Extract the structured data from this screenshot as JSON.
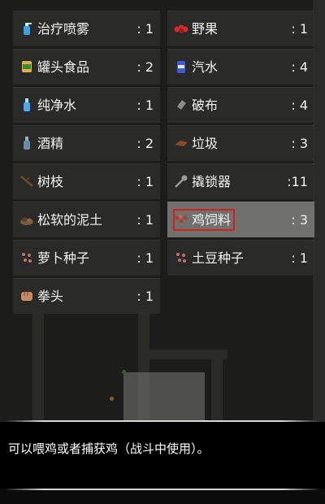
{
  "inventory": {
    "left": [
      {
        "name": "治疗喷雾",
        "qty": ": 1",
        "icon": "spray-icon",
        "color": "#3aa0e8"
      },
      {
        "name": "罐头食品",
        "qty": ": 2",
        "icon": "canned-food-icon",
        "color": "#e0b23a"
      },
      {
        "name": "纯净水",
        "qty": ": 1",
        "icon": "water-bottle-icon",
        "color": "#4aa8f0"
      },
      {
        "name": "酒精",
        "qty": ": 2",
        "icon": "alcohol-bottle-icon",
        "color": "#6a8aa8"
      },
      {
        "name": "树枝",
        "qty": ": 1",
        "icon": "branch-icon",
        "color": "#6b4a2a"
      },
      {
        "name": "松软的泥土",
        "qty": ": 1",
        "icon": "soil-icon",
        "color": "#7a5a3a"
      },
      {
        "name": "萝卜种子",
        "qty": ": 1",
        "icon": "seeds-icon",
        "color": "#c07070"
      },
      {
        "name": "拳头",
        "qty": ": 1",
        "icon": "fist-icon",
        "color": "#c98a60"
      }
    ],
    "right": [
      {
        "name": "野果",
        "qty": ": 1",
        "icon": "berries-icon",
        "color": "#d02a2a"
      },
      {
        "name": "汽水",
        "qty": ": 4",
        "icon": "soda-can-icon",
        "color": "#3a5ad8"
      },
      {
        "name": "破布",
        "qty": ": 4",
        "icon": "rag-icon",
        "color": "#8a8a8a"
      },
      {
        "name": "垃圾",
        "qty": ": 3",
        "icon": "trash-icon",
        "color": "#8a4a2a"
      },
      {
        "name": "撬锁器",
        "qty": ":11",
        "icon": "lockpick-icon",
        "color": "#9a9a9a"
      },
      {
        "name": "鸡饲料",
        "qty": ": 3",
        "icon": "chicken-feed-icon",
        "color": "#b03a3a",
        "selected": true
      },
      {
        "name": "土豆种子",
        "qty": ": 1",
        "icon": "seeds-icon",
        "color": "#c07070"
      }
    ]
  },
  "description": {
    "text": "可以喂鸡或者捕获鸡（战斗中使用）。"
  },
  "colors": {
    "highlight_border": "#d0211c",
    "selected_slot": "#767676",
    "slot": "#2c2c2c"
  }
}
